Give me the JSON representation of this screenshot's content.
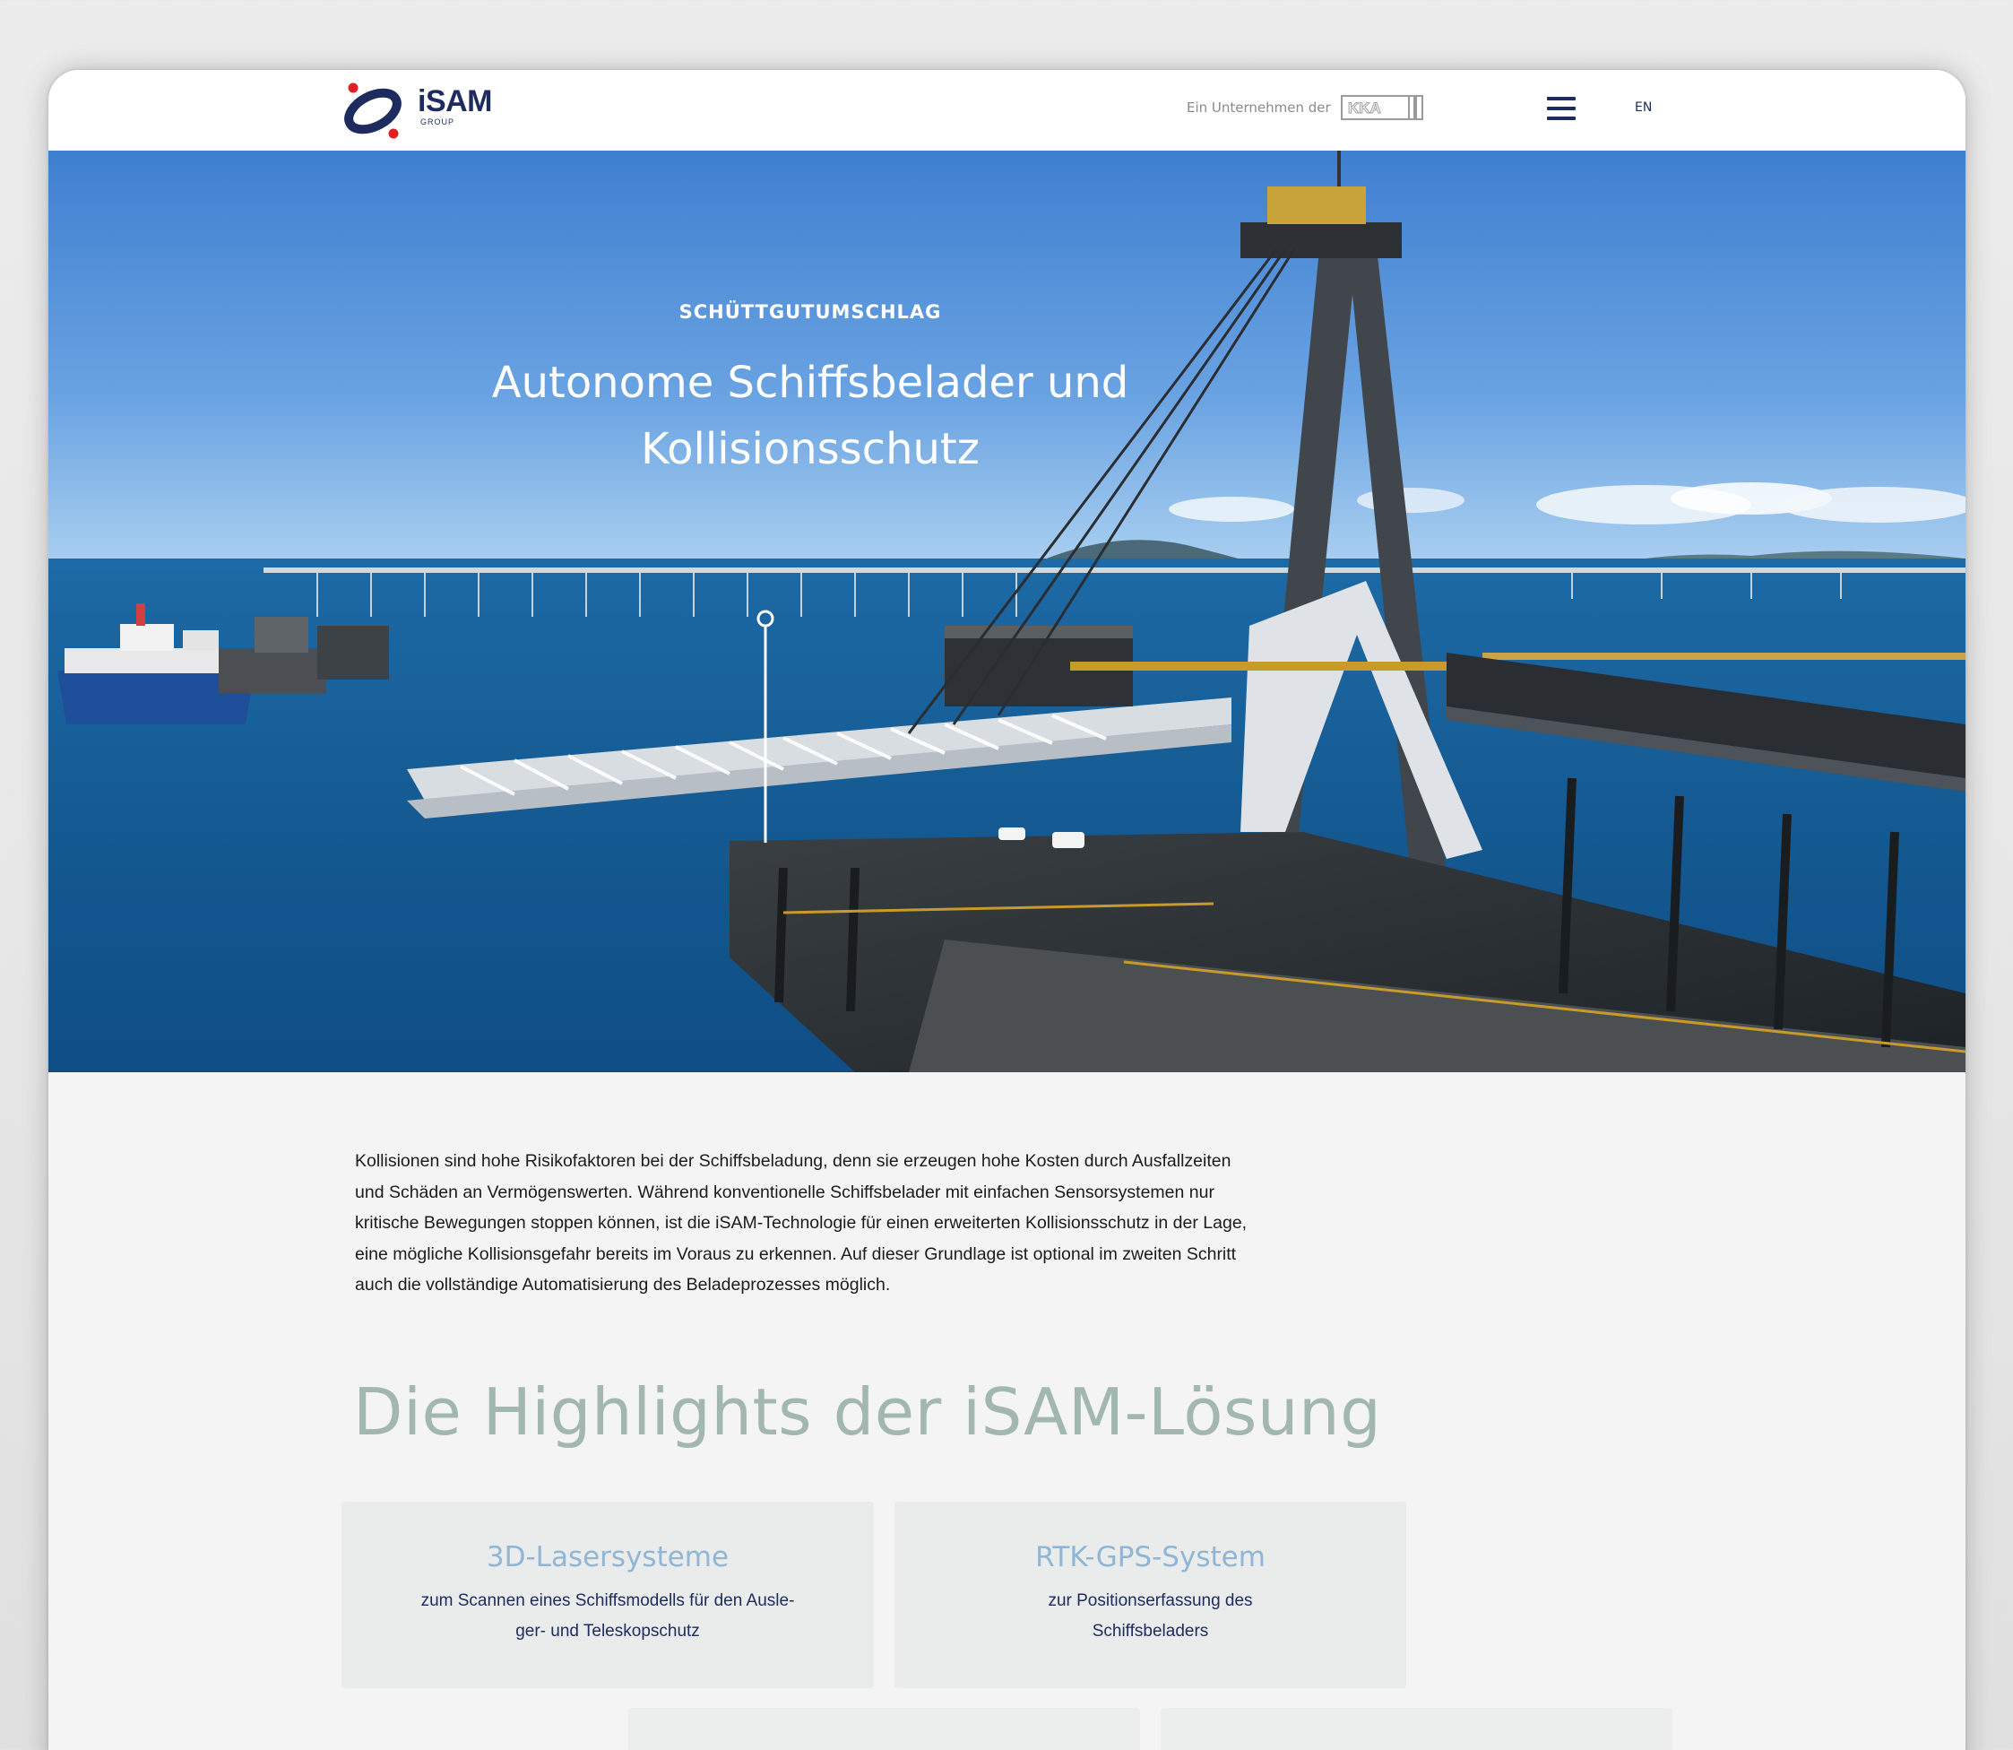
{
  "header": {
    "brand_name": "iSAM",
    "brand_sub": "GROUP",
    "company_text": "Ein Unternehmen der",
    "parent_logo_text": "KKA",
    "menu_icon": "hamburger-menu-icon",
    "language_switch": "EN",
    "colors": {
      "brand": "#1d2b5e",
      "brand_accent": "#e31e24"
    }
  },
  "hero": {
    "kicker": "SCHÜTTGUTUMSCHLAG",
    "title_line1": "Autonome Schiffsbelader und",
    "title_line2": "Kollisionsschutz"
  },
  "intro": {
    "line1": "Kollisionen sind hohe Risikofaktoren bei der Schiffsbeladung, denn sie erzeugen hohe Kosten durch Ausfallzeiten",
    "line2": "und Schäden an Vermögenswerten. Während konventionelle Schiffsbelader mit einfachen Sensorsystemen nur",
    "line3": "kritische Bewegungen stoppen können, ist die iSAM-Technologie für einen erweiterten Kollisionsschutz in der Lage,",
    "line4": "eine mögliche Kollisionsgefahr bereits im Voraus zu erkennen. Auf dieser Grundlage ist optional im zweiten Schritt",
    "line5": "auch die vollständige Automatisierung des Beladeprozesses möglich."
  },
  "highlights": {
    "title": "Die Highlights der iSAM-Lösung",
    "cards": [
      {
        "title": "3D-Lasersysteme",
        "desc_line1": "zum Scannen eines Schiffsmodells für den Ausle-",
        "desc_line2": "ger- und Teleskopschutz"
      },
      {
        "title": "RTK-GPS-System",
        "desc_line1": "zur Positionserfassung des",
        "desc_line2": "Schiffsbeladers"
      }
    ]
  }
}
